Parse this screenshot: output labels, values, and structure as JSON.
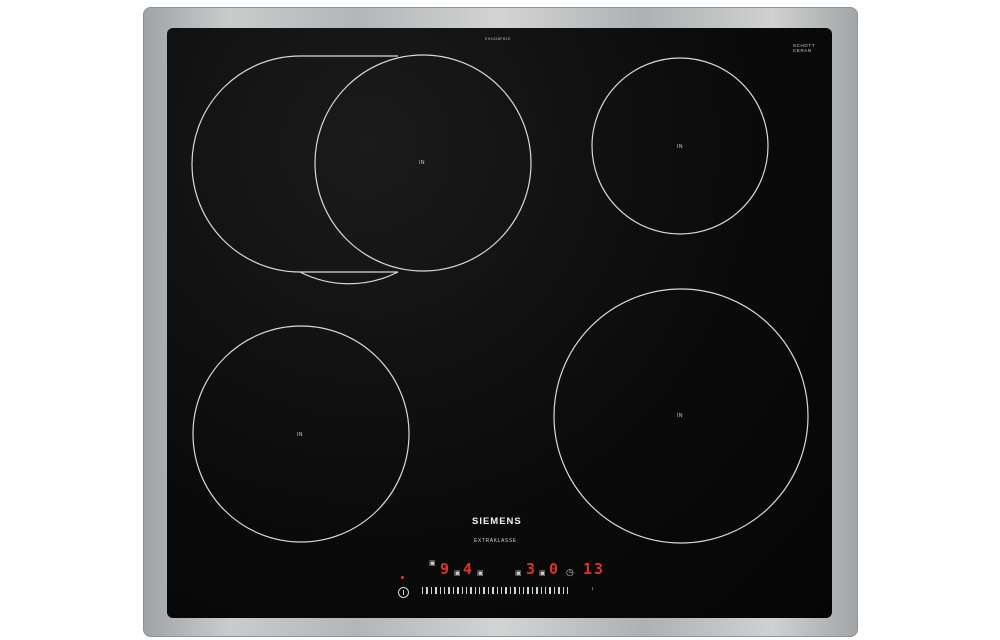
{
  "hob": {
    "brand": "SIEMENS",
    "sub_brand": "EXTRAKLASSE",
    "glass_mark": "SCHOTT CERAN",
    "top_code": "EH645BFB1E",
    "frame_color": "#b8bbbd",
    "glass_color": "#0b0b0b",
    "zone_line_color": "#d9d9d9",
    "display_color": "#e1322a"
  },
  "zones": [
    {
      "id": "flex-zone",
      "label": "IN"
    },
    {
      "id": "rear-right",
      "label": "IN"
    },
    {
      "id": "front-left",
      "label": "IN"
    },
    {
      "id": "front-right",
      "label": "IN"
    }
  ],
  "controls": {
    "display_left_power": "9",
    "display_mid_power": "4",
    "display_right_power": "3",
    "display_zero": "0",
    "timer_value": "13",
    "timer_icon": "clock-icon",
    "power_icon": "power-icon",
    "slider_icon": "power-level-slider"
  }
}
